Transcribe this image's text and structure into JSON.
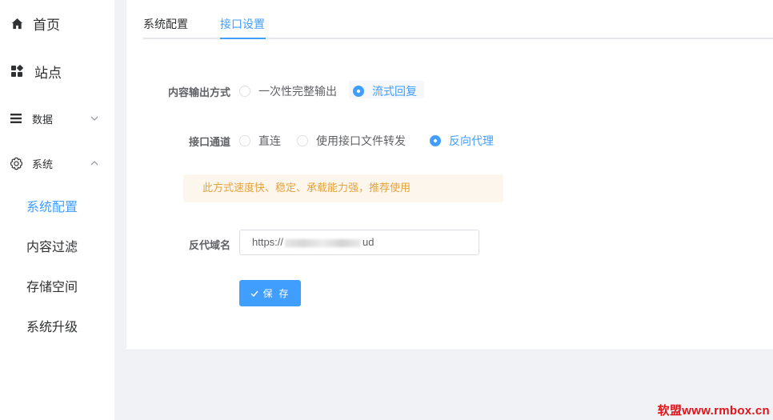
{
  "sidebar": {
    "items": [
      {
        "label": "首页",
        "icon": "home-icon"
      },
      {
        "label": "站点",
        "icon": "grid-icon"
      },
      {
        "label": "数据",
        "icon": "list-icon",
        "expanded": false
      },
      {
        "label": "系统",
        "icon": "gear-icon",
        "expanded": true
      }
    ],
    "sub_items": [
      "系统配置",
      "内容过滤",
      "存储空间",
      "系统升级"
    ],
    "active_sub": "系统配置"
  },
  "tabs": [
    {
      "label": "系统配置",
      "active": false
    },
    {
      "label": "接口设置",
      "active": true
    }
  ],
  "form": {
    "output_mode": {
      "label": "内容输出方式",
      "options": [
        "一次性完整输出",
        "流式回复"
      ],
      "selected": "流式回复"
    },
    "channel": {
      "label": "接口通道",
      "options": [
        "直连",
        "使用接口文件转发",
        "反向代理"
      ],
      "selected": "反向代理"
    },
    "notice": "此方式速度快、稳定、承载能力强，推荐使用",
    "proxy_domain": {
      "label": "反代域名",
      "value_prefix": "https://",
      "value_suffix": "ud"
    },
    "save_label": "保 存"
  },
  "watermark": "软盟www.rmbox.cn",
  "colors": {
    "accent": "#409eff",
    "warning_text": "#e6a23c",
    "warning_bg": "#fdf6ec",
    "watermark": "#e0141a"
  }
}
